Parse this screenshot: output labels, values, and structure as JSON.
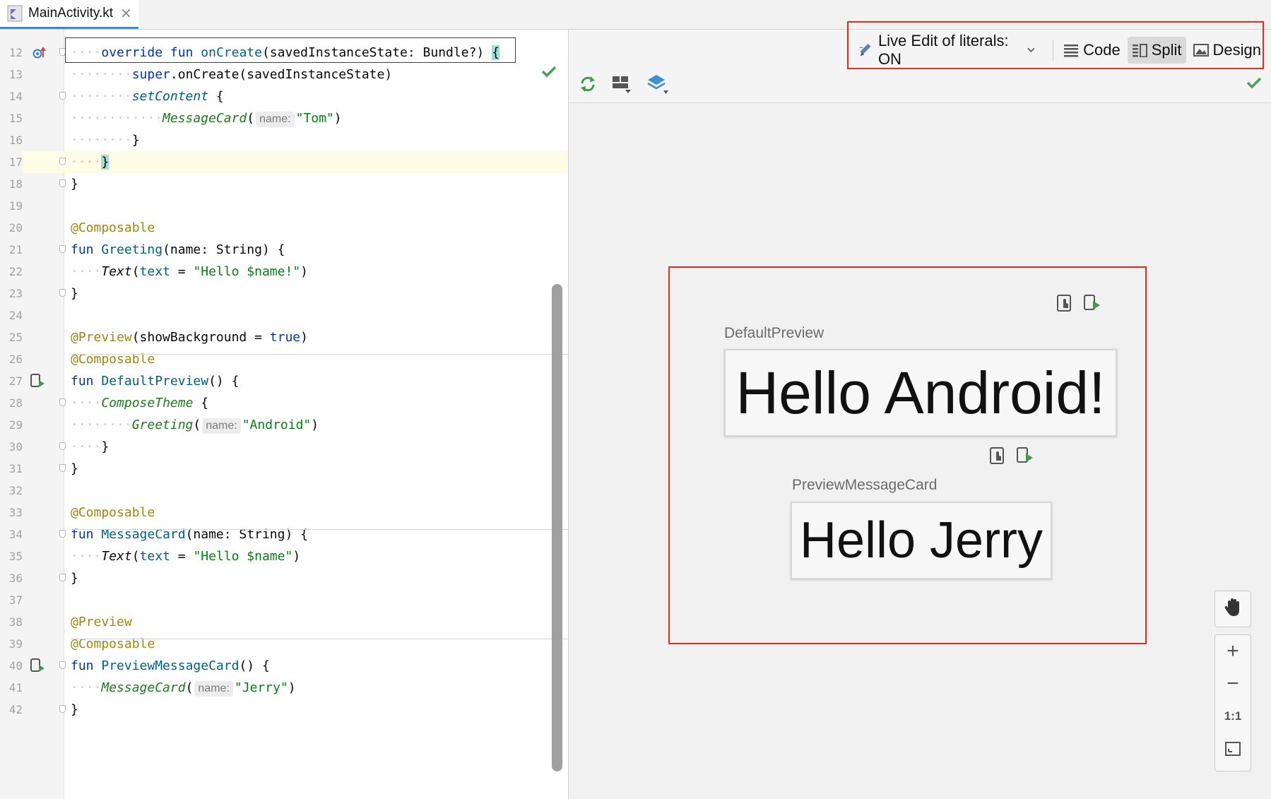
{
  "tab": {
    "filename": "MainActivity.kt",
    "close_icon": "close-icon"
  },
  "editor": {
    "lines": [
      {
        "n": "12"
      },
      {
        "n": "13"
      },
      {
        "n": "14"
      },
      {
        "n": "15"
      },
      {
        "n": "16"
      },
      {
        "n": "17"
      },
      {
        "n": "18"
      },
      {
        "n": "19"
      },
      {
        "n": "20"
      },
      {
        "n": "21"
      },
      {
        "n": "22"
      },
      {
        "n": "23"
      },
      {
        "n": "24"
      },
      {
        "n": "25"
      },
      {
        "n": "26"
      },
      {
        "n": "27"
      },
      {
        "n": "28"
      },
      {
        "n": "29"
      },
      {
        "n": "30"
      },
      {
        "n": "31"
      },
      {
        "n": "32"
      },
      {
        "n": "33"
      },
      {
        "n": "34"
      },
      {
        "n": "35"
      },
      {
        "n": "36"
      },
      {
        "n": "37"
      },
      {
        "n": "38"
      },
      {
        "n": "39"
      },
      {
        "n": "40"
      },
      {
        "n": "41"
      },
      {
        "n": "42"
      }
    ],
    "t": {
      "override": "override",
      "fun": "fun",
      "onCreate": "onCreate",
      "onCreateParams": "(savedInstanceState: Bundle?) ",
      "openBrace": "{",
      "closeBrace": "}",
      "superCall": "super",
      "superRest": ".onCreate(savedInstanceState)",
      "setContent": "setContent",
      "spBrace": " {",
      "messageCard": "MessageCard",
      "paren": "(",
      "closeParen": ")",
      "hintName": "name:",
      "strTom": "\"Tom\"",
      "composable": "@Composable",
      "greeting": "Greeting",
      "nameString": "(name: String) {",
      "text": "Text",
      "textParam": "text",
      "eq": " = ",
      "strHelloNameBang": "\"Hello $name!\"",
      "preview": "@Preview",
      "showBgOpen": "(showBackground = ",
      "true": "true",
      "defaultPreview": "DefaultPreview",
      "emptyParams": "() {",
      "composeTheme": "ComposeTheme",
      "strAndroid": "\"Android\"",
      "messageCardDecl": "MessageCard",
      "strHelloName": "\"Hello $name\"",
      "previewMessageCard": "PreviewMessageCard",
      "strJerry": "\"Jerry\""
    }
  },
  "design": {
    "modes": {
      "live_edit": "Live Edit of literals: ON",
      "code": "Code",
      "split": "Split",
      "design": "Design"
    },
    "previews": [
      {
        "title": "DefaultPreview",
        "text": "Hello Android!"
      },
      {
        "title": "PreviewMessageCard",
        "text": "Hello Jerry"
      }
    ],
    "zoom": {
      "plus": "+",
      "minus": "−",
      "reset": "1:1"
    }
  },
  "colors": {
    "accent_red": "#e8291c",
    "check_green": "#4aa15b",
    "refresh_green": "#3d9a4e"
  }
}
